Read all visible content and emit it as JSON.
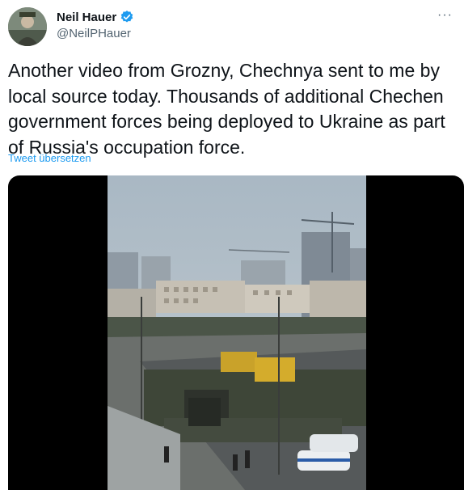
{
  "author": {
    "display_name": "Neil Hauer",
    "handle": "@NeilPHauer",
    "verified": true,
    "avatar_icon": "profile-photo",
    "verified_icon": "verified-badge-icon"
  },
  "tweet": {
    "text": "Another video from Grozny, Chechnya sent to me by local source today. Thousands of additional Chechen government forces being deployed to Ukraine as part of Russia's occupation force.",
    "translate_link": "Tweet übersetzen"
  },
  "menu": {
    "icon": "more-options-icon",
    "label": "···"
  },
  "media": {
    "type": "video",
    "icon": "video-thumbnail"
  },
  "colors": {
    "text": "#0f1419",
    "secondary_text": "#536471",
    "link": "#1d9bf0",
    "verified": "#1d9bf0",
    "media_background": "#000000"
  }
}
